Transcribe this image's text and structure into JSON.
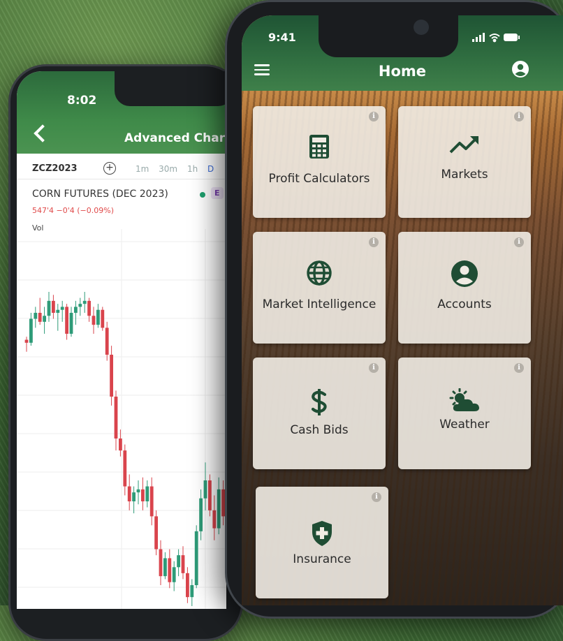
{
  "back_phone": {
    "time": "8:02",
    "title": "Advanced Chart",
    "symbol": "ZCZ2023",
    "timeframes": [
      "1m",
      "30m",
      "1h",
      "D"
    ],
    "active_timeframe": "D",
    "contract_name": "CORN FUTURES (DEC 2023)",
    "badge": "E",
    "quote": "547'4  −0'4 (−0.09%)",
    "volume_label": "Vol"
  },
  "front_phone": {
    "time": "9:41",
    "title": "Home",
    "tiles": [
      {
        "label": "Profit Calculators",
        "icon": "calculator-icon"
      },
      {
        "label": "Markets",
        "icon": "trending-up-icon"
      },
      {
        "label": "Market Intelligence",
        "icon": "globe-icon"
      },
      {
        "label": "Accounts",
        "icon": "user-circle-icon"
      },
      {
        "label": "Cash Bids",
        "icon": "dollar-icon"
      },
      {
        "label": "Weather",
        "icon": "sun-cloud-icon"
      },
      {
        "label": "Insurance",
        "icon": "shield-plus-icon"
      }
    ],
    "info_glyph": "i"
  },
  "colors": {
    "brand_green": "#2f6d40",
    "icon_green": "#1f4d34",
    "bull": "#2e9b78",
    "bear": "#d9444c"
  },
  "chart_data": {
    "type": "candlestick",
    "symbol": "ZCZ2023",
    "title": "CORN FUTURES (DEC 2023)",
    "last": "547'4",
    "change": "−0'4",
    "change_pct": "−0.09%",
    "candles": [
      {
        "o": 544,
        "h": 546,
        "l": 536,
        "c": 542
      },
      {
        "o": 542,
        "h": 562,
        "l": 540,
        "c": 558
      },
      {
        "o": 558,
        "h": 566,
        "l": 552,
        "c": 562
      },
      {
        "o": 562,
        "h": 572,
        "l": 554,
        "c": 556
      },
      {
        "o": 556,
        "h": 566,
        "l": 548,
        "c": 560
      },
      {
        "o": 560,
        "h": 576,
        "l": 556,
        "c": 570
      },
      {
        "o": 570,
        "h": 574,
        "l": 558,
        "c": 562
      },
      {
        "o": 562,
        "h": 568,
        "l": 550,
        "c": 564
      },
      {
        "o": 564,
        "h": 570,
        "l": 556,
        "c": 566
      },
      {
        "o": 566,
        "h": 568,
        "l": 544,
        "c": 548
      },
      {
        "o": 548,
        "h": 566,
        "l": 546,
        "c": 562
      },
      {
        "o": 562,
        "h": 570,
        "l": 554,
        "c": 566
      },
      {
        "o": 566,
        "h": 572,
        "l": 560,
        "c": 568
      },
      {
        "o": 568,
        "h": 576,
        "l": 562,
        "c": 570
      },
      {
        "o": 570,
        "h": 572,
        "l": 556,
        "c": 560
      },
      {
        "o": 560,
        "h": 566,
        "l": 548,
        "c": 554
      },
      {
        "o": 554,
        "h": 568,
        "l": 552,
        "c": 564
      },
      {
        "o": 564,
        "h": 566,
        "l": 550,
        "c": 552
      },
      {
        "o": 552,
        "h": 556,
        "l": 530,
        "c": 534
      },
      {
        "o": 534,
        "h": 540,
        "l": 500,
        "c": 506
      },
      {
        "o": 506,
        "h": 510,
        "l": 470,
        "c": 478
      },
      {
        "o": 478,
        "h": 484,
        "l": 466,
        "c": 470
      },
      {
        "o": 470,
        "h": 474,
        "l": 440,
        "c": 446
      },
      {
        "o": 446,
        "h": 454,
        "l": 430,
        "c": 436
      },
      {
        "o": 436,
        "h": 446,
        "l": 428,
        "c": 442
      },
      {
        "o": 442,
        "h": 450,
        "l": 434,
        "c": 444
      },
      {
        "o": 444,
        "h": 452,
        "l": 430,
        "c": 436
      },
      {
        "o": 436,
        "h": 450,
        "l": 432,
        "c": 446
      },
      {
        "o": 446,
        "h": 452,
        "l": 420,
        "c": 426
      },
      {
        "o": 426,
        "h": 430,
        "l": 400,
        "c": 404
      },
      {
        "o": 404,
        "h": 410,
        "l": 380,
        "c": 386
      },
      {
        "o": 386,
        "h": 402,
        "l": 384,
        "c": 398
      },
      {
        "o": 398,
        "h": 404,
        "l": 378,
        "c": 382
      },
      {
        "o": 382,
        "h": 396,
        "l": 376,
        "c": 392
      },
      {
        "o": 392,
        "h": 404,
        "l": 386,
        "c": 400
      },
      {
        "o": 400,
        "h": 406,
        "l": 384,
        "c": 388
      },
      {
        "o": 388,
        "h": 392,
        "l": 368,
        "c": 372
      },
      {
        "o": 372,
        "h": 384,
        "l": 366,
        "c": 380
      },
      {
        "o": 380,
        "h": 420,
        "l": 378,
        "c": 416
      },
      {
        "o": 416,
        "h": 444,
        "l": 410,
        "c": 438
      },
      {
        "o": 438,
        "h": 462,
        "l": 430,
        "c": 450
      },
      {
        "o": 450,
        "h": 454,
        "l": 426,
        "c": 430
      },
      {
        "o": 430,
        "h": 440,
        "l": 410,
        "c": 418
      },
      {
        "o": 418,
        "h": 452,
        "l": 414,
        "c": 444
      },
      {
        "o": 444,
        "h": 450,
        "l": 420,
        "c": 426
      },
      {
        "o": 426,
        "h": 446,
        "l": 402,
        "c": 408
      }
    ]
  }
}
